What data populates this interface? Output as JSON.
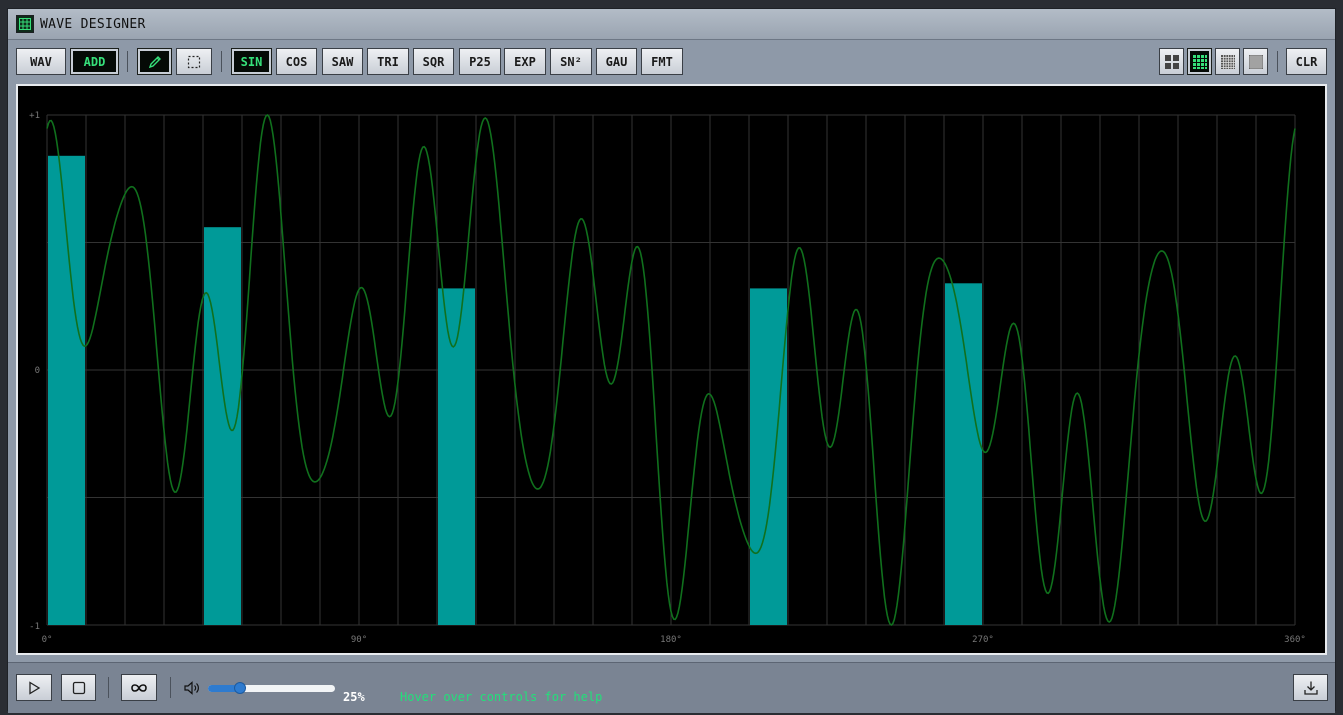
{
  "window": {
    "title": "WAVE DESIGNER",
    "icon": "grid-icon"
  },
  "toolbar": {
    "mode_buttons": [
      {
        "label": "WAV",
        "active": false
      },
      {
        "label": "ADD",
        "active": true
      }
    ],
    "tool_buttons": [
      {
        "icon": "pencil-icon",
        "active": true
      },
      {
        "icon": "select-rect-icon",
        "active": false
      }
    ],
    "wave_buttons": [
      {
        "label": "SIN",
        "active": true
      },
      {
        "label": "COS",
        "active": false
      },
      {
        "label": "SAW",
        "active": false
      },
      {
        "label": "TRI",
        "active": false
      },
      {
        "label": "SQR",
        "active": false
      },
      {
        "label": "P25",
        "active": false
      },
      {
        "label": "EXP",
        "active": false
      },
      {
        "label": "SN²",
        "active": false
      },
      {
        "label": "GAU",
        "active": false
      },
      {
        "label": "FMT",
        "active": false
      }
    ],
    "grid_buttons": [
      {
        "icon": "grid-2x2-icon",
        "active": false
      },
      {
        "icon": "grid-4x4-icon",
        "active": true
      },
      {
        "icon": "grid-6x6-icon",
        "active": false
      },
      {
        "icon": "grid-8x8-icon",
        "active": false
      }
    ],
    "clear_label": "CLR"
  },
  "scope": {
    "y_labels": {
      "top": "+1",
      "mid": "0",
      "bottom": "-1"
    },
    "x_labels": [
      "0°",
      "90°",
      "180°",
      "270°",
      "360°"
    ],
    "colors": {
      "bar": "#009a98",
      "wave": "#10701d",
      "grid": "#333333"
    },
    "bars": [
      {
        "bin": 0,
        "amplitude": 0.92
      },
      {
        "bin": 4,
        "amplitude": 0.78
      },
      {
        "bin": 10,
        "amplitude": 0.66
      },
      {
        "bin": 18,
        "amplitude": 0.66
      },
      {
        "bin": 23,
        "amplitude": 0.67
      }
    ]
  },
  "bottom": {
    "play_icon": "play-icon",
    "stop_icon": "stop-icon",
    "loop_icon": "loop-icon",
    "volume_icon": "speaker-icon",
    "volume": 25,
    "volume_label": "25%",
    "help_text": "Hover over controls for help",
    "export_icon": "download-icon"
  }
}
